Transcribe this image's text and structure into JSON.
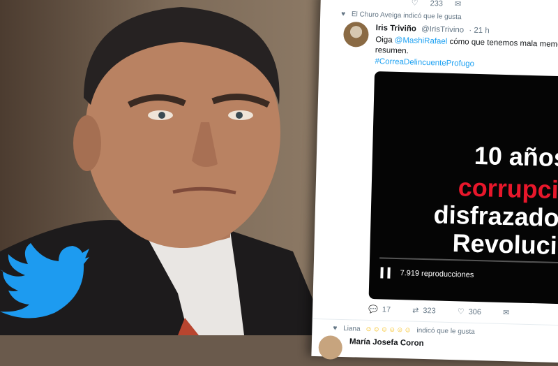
{
  "top_actions": {
    "likes": "233"
  },
  "liked_by_top": "El Churo Aveiga indicó que le gusta",
  "tweet": {
    "author_name": "Iris Triviño",
    "handle": "@IrisTrivino",
    "time": "· 21 h",
    "text_lead": "Oiga ",
    "mention": "@MashiRafael",
    "text_rest": " cómo que tenemos mala memo",
    "text_line2": "resumen.",
    "hashtag": "#CorreaDelincuenteProfugo"
  },
  "video": {
    "line1": "10 años",
    "line2": "corrupció",
    "line3": "disfrazados",
    "line4": "Revolució",
    "views": "7.919 reproducciones",
    "progress": 0.0
  },
  "actions": {
    "replies": "17",
    "retweets": "323",
    "likes": "306"
  },
  "liked_by_bottom": {
    "name": "Liana",
    "text": "indicó que le gusta"
  },
  "next_author": "María Josefa Coron",
  "colors": {
    "twitter_blue": "#1da1f2",
    "red_text": "#e8172b"
  },
  "icons": [
    "twitter-bird-icon",
    "heart-icon",
    "reply-icon",
    "retweet-icon",
    "mail-icon",
    "pause-icon"
  ]
}
